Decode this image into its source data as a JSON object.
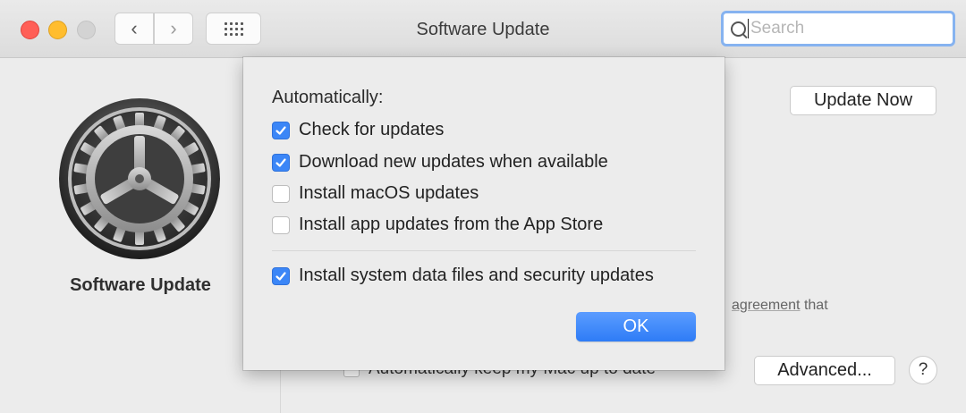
{
  "window": {
    "title": "Software Update",
    "nav": {
      "back_glyph": "‹",
      "forward_glyph": "›"
    },
    "search": {
      "placeholder": "Search",
      "value": ""
    }
  },
  "left_pane": {
    "icon": "software-update-gear-icon",
    "title": "Software Update"
  },
  "main": {
    "update_now_label": "Update Now",
    "agreement_link": "agreement",
    "agreement_rest": " that",
    "auto_keep_label": "Automatically keep my Mac up to date",
    "auto_keep_checked": false,
    "advanced_label": "Advanced...",
    "help_label": "?"
  },
  "sheet": {
    "heading": "Automatically:",
    "options": [
      {
        "label": "Check for updates",
        "checked": true
      },
      {
        "label": "Download new updates when available",
        "checked": true
      },
      {
        "label": "Install macOS updates",
        "checked": false
      },
      {
        "label": "Install app updates from the App Store",
        "checked": false
      }
    ],
    "security_option": {
      "label": "Install system data files and security updates",
      "checked": true
    },
    "ok_label": "OK"
  },
  "colors": {
    "accent": "#3b86f7",
    "close": "#ff5f57",
    "minimize": "#ffbd2e",
    "maximize_disabled": "#d3d3d3"
  }
}
